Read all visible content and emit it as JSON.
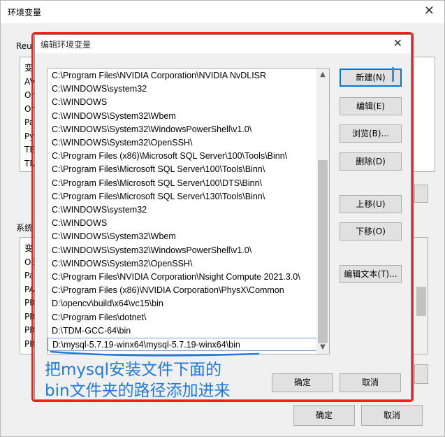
{
  "background_window": {
    "title": "环境变量",
    "close_glyph": "✕",
    "user_group_label": "Reu",
    "user_rows": [
      "变",
      "AV",
      "Or",
      "Or",
      "Pa",
      "Py",
      "TE",
      "TN"
    ],
    "system_group_label": "系统",
    "system_rows": [
      "变",
      "OS",
      "Pa",
      "PA",
      "PR",
      "PR",
      "PR",
      "PR"
    ],
    "ok_label": "确定",
    "cancel_label": "取消"
  },
  "edit_dialog": {
    "title": "编辑环境变量",
    "close_glyph": "✕",
    "paths": [
      "C:\\Program Files\\NVIDIA Corporation\\NVIDIA NvDLISR",
      "C:\\WINDOWS\\system32",
      "C:\\WINDOWS",
      "C:\\WINDOWS\\System32\\Wbem",
      "C:\\WINDOWS\\System32\\WindowsPowerShell\\v1.0\\",
      "C:\\WINDOWS\\System32\\OpenSSH\\",
      "C:\\Program Files (x86)\\Microsoft SQL Server\\100\\Tools\\Binn\\",
      "C:\\Program Files\\Microsoft SQL Server\\100\\Tools\\Binn\\",
      "C:\\Program Files\\Microsoft SQL Server\\100\\DTS\\Binn\\",
      "C:\\Program Files\\Microsoft SQL Server\\130\\Tools\\Binn\\",
      "C:\\WINDOWS\\system32",
      "C:\\WINDOWS",
      "C:\\WINDOWS\\System32\\Wbem",
      "C:\\WINDOWS\\System32\\WindowsPowerShell\\v1.0\\",
      "C:\\WINDOWS\\System32\\OpenSSH\\",
      "C:\\Program Files\\NVIDIA Corporation\\Nsight Compute 2021.3.0\\",
      "C:\\Program Files (x86)\\NVIDIA Corporation\\PhysX\\Common",
      "D:\\opencv\\build\\x64\\vc15\\bin",
      "C:\\Program Files\\dotnet\\",
      "D:\\TDM-GCC-64\\bin",
      "D:\\mysql-5.7.19-winx64\\mysql-5.7.19-winx64\\bin"
    ],
    "selected_index": 20,
    "buttons": {
      "new": "新建(N)",
      "edit": "编辑(E)",
      "browse": "浏览(B)...",
      "delete": "删除(D)",
      "move_up": "上移(U)",
      "move_down": "下移(O)",
      "edit_text": "编辑文本(T)..."
    },
    "ok_label": "确定",
    "cancel_label": "取消"
  },
  "annotation": {
    "line1": "把mysql安装文件下面的",
    "line2": "bin文件夹的路径添加进来",
    "color": "#1f7ae0",
    "frame_color": "#ff1a1a"
  }
}
